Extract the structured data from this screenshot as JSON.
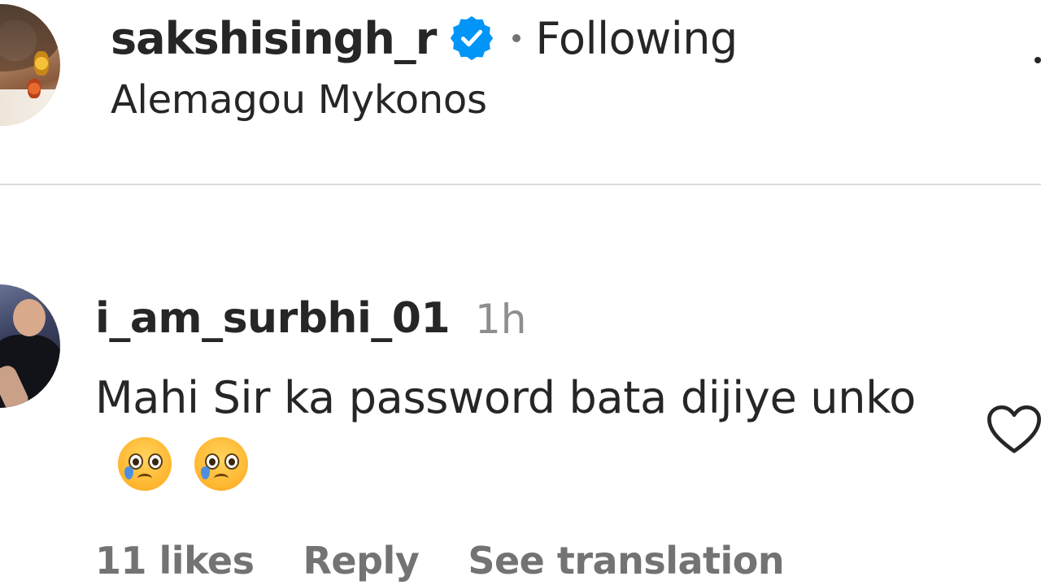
{
  "post_header": {
    "username": "sakshisingh_r",
    "verified": true,
    "separator": "•",
    "follow_status": "Following",
    "location": "Alemagou Mykonos"
  },
  "comment": {
    "author": "i_am_surbhi_01",
    "time": "1h",
    "text": "Mahi Sir ka password bata dijiye unko",
    "emojis": [
      "crying-face",
      "crying-face"
    ],
    "likes_label": "11 likes",
    "reply_label": "Reply",
    "translate_label": "See translation"
  },
  "icons": {
    "verified": "verified-badge-icon",
    "like": "heart-outline-icon",
    "more": "more-options-icon"
  },
  "colors": {
    "verified_blue": "#0095f6",
    "text_primary": "#262626",
    "text_secondary": "#737373",
    "divider": "#dbdbdb"
  }
}
